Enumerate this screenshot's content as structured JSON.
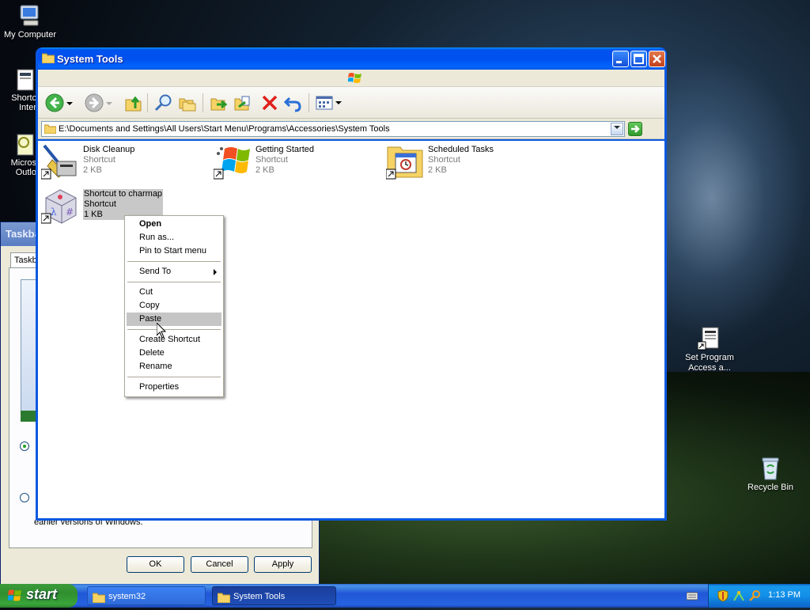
{
  "desktop": {
    "icons": [
      {
        "label": "My Computer"
      },
      {
        "label": "Shortc Inter"
      },
      {
        "label": "Micros Outlo"
      },
      {
        "label": "Set Program Access a..."
      },
      {
        "label": "Recycle Bin"
      }
    ]
  },
  "bg_dialog": {
    "title": "Taskba",
    "tab": "Taskb",
    "note": "earlier versions of Windows.",
    "buttons": {
      "ok": "OK",
      "cancel": "Cancel",
      "apply": "Apply"
    }
  },
  "window": {
    "title": "System Tools",
    "address": "E:\\Documents and Settings\\All Users\\Start Menu\\Programs\\Accessories\\System Tools",
    "items": [
      {
        "name": "Disk Cleanup",
        "type": "Shortcut",
        "size": "2 KB"
      },
      {
        "name": "Getting Started",
        "type": "Shortcut",
        "size": "2 KB"
      },
      {
        "name": "Scheduled Tasks",
        "type": "Shortcut",
        "size": "2 KB"
      },
      {
        "name": "Shortcut to charmap",
        "type": "Shortcut",
        "size": "1 KB"
      }
    ]
  },
  "context_menu": {
    "open": "Open",
    "run_as": "Run as...",
    "pin": "Pin to Start menu",
    "send_to": "Send To",
    "cut": "Cut",
    "copy": "Copy",
    "paste": "Paste",
    "create_shortcut": "Create Shortcut",
    "delete": "Delete",
    "rename": "Rename",
    "properties": "Properties"
  },
  "taskbar": {
    "start": "start",
    "tasks": [
      {
        "label": "system32"
      },
      {
        "label": "System Tools"
      }
    ],
    "clock": "1:13 PM"
  },
  "colors": {
    "xp_blue": "#0054e3",
    "start_green": "#3a9a3a",
    "menu_highlight": "#c5c5c5"
  }
}
